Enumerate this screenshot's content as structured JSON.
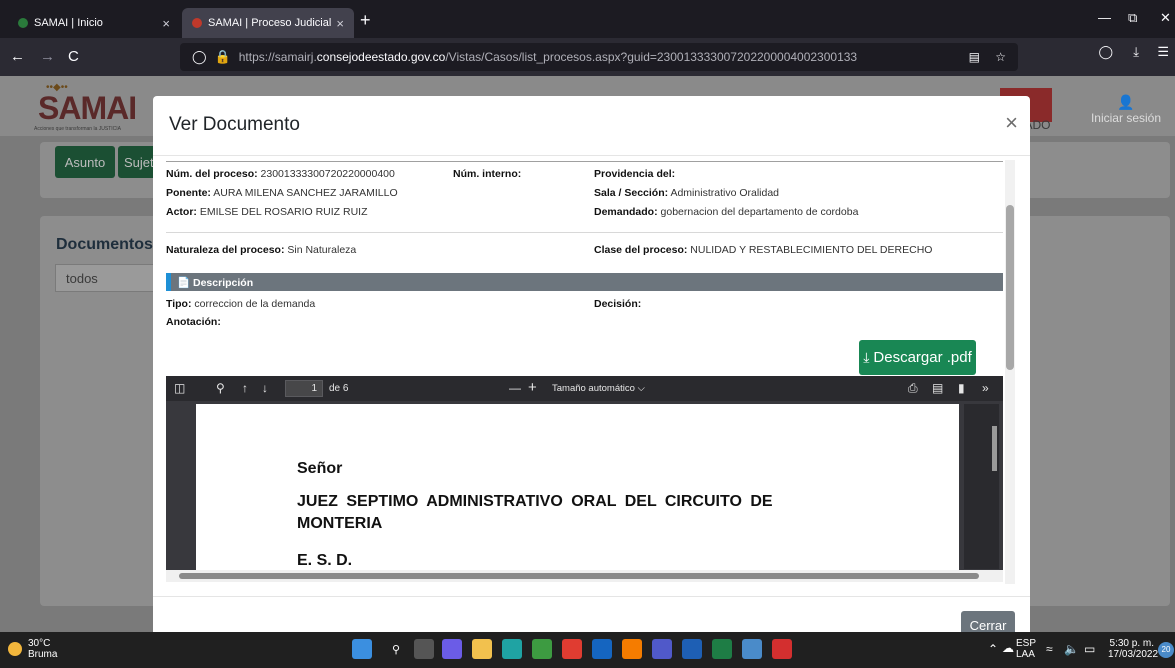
{
  "browser": {
    "tabs": [
      {
        "title": "SAMAI | Inicio",
        "close": "×"
      },
      {
        "title": "SAMAI | Proceso Judicial",
        "close": "×"
      }
    ],
    "new_tab": "+",
    "window_controls": {
      "minimize": "—",
      "restore": "⧉",
      "close": "✕"
    },
    "nav": {
      "back": "←",
      "forward": "→",
      "reload": "C"
    },
    "url_prefix": "https://samairj.",
    "url_domain": "consejodeestado.gov.co",
    "url_rest": "/Vistas/Casos/list_procesos.aspx?guid=230013333007202200004002300133",
    "toolbar_icons": [
      "reader-icon",
      "bookmark-star-icon",
      "pocket-icon",
      "download-icon",
      "menu-icon"
    ]
  },
  "page": {
    "logo_text": "SAMAI",
    "logo_sub": "Acciones que transforman la JUSTICIA",
    "login_label": "Iniciar sesión",
    "estado_fragment": "TADO",
    "asunto_button": "Asunto",
    "sujeto_button": "Sujet",
    "documents_title": "Documentos",
    "filter_value": "todos"
  },
  "modal": {
    "title": "Ver Documento",
    "close": "×",
    "fields": {
      "num_proceso_label": "Núm. del proceso:",
      "num_proceso": "23001333300720220000400",
      "num_interno_label": "Núm. interno:",
      "num_interno": "",
      "providencia_label": "Providencia del:",
      "providencia": "",
      "ponente_label": "Ponente:",
      "ponente": "AURA MILENA SANCHEZ JARAMILLO",
      "sala_label": "Sala / Sección:",
      "sala": "Administrativo Oralidad",
      "actor_label": "Actor:",
      "actor": "EMILSE DEL ROSARIO RUIZ RUIZ",
      "demandado_label": "Demandado:",
      "demandado": "gobernacion del departamento de cordoba",
      "naturaleza_label": "Naturaleza del proceso:",
      "naturaleza": "Sin Naturaleza",
      "clase_label": "Clase del proceso:",
      "clase": "NULIDAD Y RESTABLECIMIENTO DEL DERECHO",
      "descripcion_header": "Descripción",
      "tipo_label": "Tipo:",
      "tipo": "correccion de la demanda",
      "decision_label": "Decisión:",
      "decision": "",
      "anotacion_label": "Anotación:",
      "anotacion": ""
    },
    "download_label": "Descargar .pdf",
    "close_button": "Cerrar"
  },
  "pdf_viewer": {
    "current_page": "1",
    "page_total": "de 6",
    "zoom": "Tamaño automático",
    "zoom_out": "—",
    "zoom_in": "+",
    "more": "»",
    "page_text": {
      "line1": "Señor",
      "line2": "JUEZ SEPTIMO ADMINISTRATIVO ORAL DEL CIRCUITO DE",
      "line3": "MONTERIA",
      "line4": "E. S. D."
    }
  },
  "taskbar": {
    "temperature": "30°C",
    "weather": "Bruma",
    "lang": "ESP",
    "layout": "LAA",
    "time": "5:30 p. m.",
    "date": "17/03/2022",
    "notifications": "20"
  }
}
